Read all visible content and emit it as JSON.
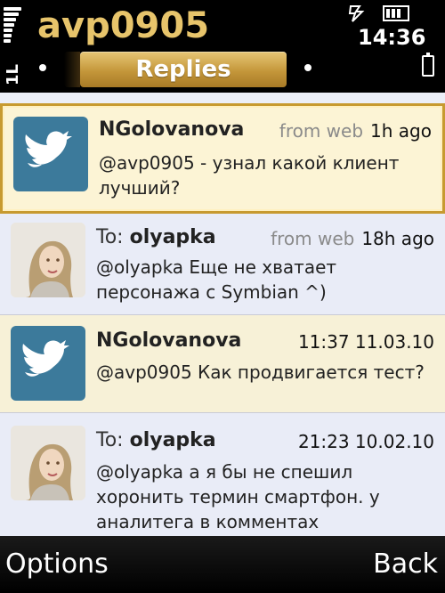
{
  "status": {
    "app_title": "avp0905",
    "clock": "14:36",
    "signal_icon": "signal-strength-icon",
    "network_label": "1L",
    "battery_icon": "battery-icon"
  },
  "tabs": {
    "current_label": "Replies"
  },
  "tweets": [
    {
      "avatar": "twitter-bird",
      "prefix": "",
      "name": "NGolovanova",
      "source": "from web",
      "time": "1h ago",
      "text": "@avp0905 - узнал какой клиент лучший?"
    },
    {
      "avatar": "user-photo",
      "prefix": "To: ",
      "name": "olyapka",
      "source": "from web",
      "time": "18h ago",
      "text": "@olyapka Еще не хватает персонажа с Symbian ^)"
    },
    {
      "avatar": "twitter-bird",
      "prefix": "",
      "name": "NGolovanova",
      "source": "",
      "time": "11:37 11.03.10",
      "text": "@avp0905 Как продвигается тест?"
    },
    {
      "avatar": "user-photo",
      "prefix": "To: ",
      "name": "olyapka",
      "source": "",
      "time": "21:23 10.02.10",
      "text": "@olyapka а я бы не спешил хоронить термин смартфон. у аналитега в комментах"
    }
  ],
  "softkeys": {
    "left": "Options",
    "right": "Back"
  },
  "colors": {
    "accent_gold": "#c79a30",
    "title_gold": "#e7c46b",
    "twitter_blue": "#3c7a9b"
  }
}
